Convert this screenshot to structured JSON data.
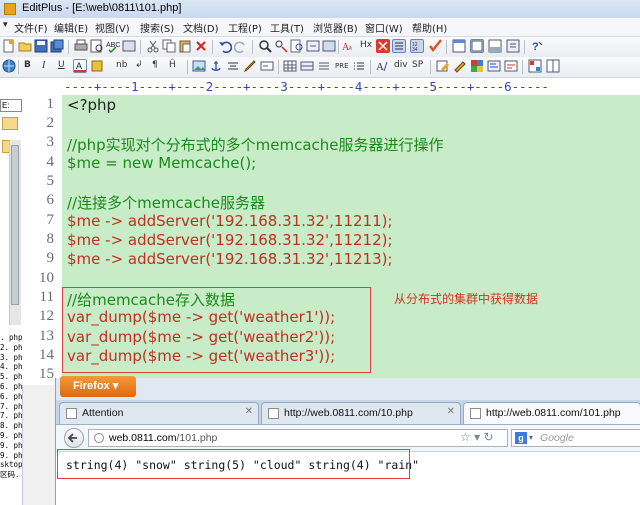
{
  "window": {
    "title": "EditPlus - [E:\\web\\0811\\101.php]"
  },
  "menu": [
    "文件(F)",
    "编辑(E)",
    "视图(V)",
    "搜索(S)",
    "文档(D)",
    "工程(P)",
    "工具(T)",
    "浏览器(B)",
    "窗口(W)",
    "帮助(H)"
  ],
  "toolbar2_text": {
    "nb": "nb",
    "tt": "tt",
    "div": "div",
    "sp": "SP",
    "hx": "Hx"
  },
  "sidebar": {
    "drive": "E:",
    "files": [
      ". php",
      "2. php",
      "3. php",
      "4. php",
      "5. php",
      "6. ph",
      "6. ph",
      "7. ph",
      "7. ph",
      "8. ph",
      "9. ph",
      "9. ph",
      "9. ph",
      "sktop",
      "区码. z"
    ]
  },
  "ruler": "----+----1----+----2----+----3----+----4----+----5----+----6-----",
  "editor": {
    "lines": [
      {
        "n": "1",
        "text": "<?php"
      },
      {
        "n": "2",
        "text": ""
      },
      {
        "n": "3",
        "text": "//php实现对个分布式的多个memcache服务器进行操作"
      },
      {
        "n": "4",
        "text": "$me = new Memcache();"
      },
      {
        "n": "5",
        "text": ""
      },
      {
        "n": "6",
        "text": "//连接多个memcache服务器"
      },
      {
        "n": "7",
        "text": "$me -> addServer('192.168.31.32',11211);"
      },
      {
        "n": "8",
        "text": "$me -> addServer('192.168.31.32',11212);"
      },
      {
        "n": "9",
        "text": "$me -> addServer('192.168.31.32',11213);"
      },
      {
        "n": "10",
        "text": ""
      },
      {
        "n": "11",
        "text": "//给memcache存入数据"
      },
      {
        "n": "12",
        "text": "var_dump($me -> get('weather1'));"
      },
      {
        "n": "13",
        "text": "var_dump($me -> get('weather2'));"
      },
      {
        "n": "14",
        "text": "var_dump($me -> get('weather3'));"
      },
      {
        "n": "15",
        "text": ""
      }
    ]
  },
  "annotation": "从分布式的集群中获得数据",
  "browser": {
    "firefox_button": "Firefox",
    "tabs": [
      {
        "label": "Attention"
      },
      {
        "label": "http://web.0811.com/10.php"
      },
      {
        "label": "http://web.0811.com/101.php"
      }
    ],
    "url_host": "web.0811.com",
    "url_path": "/101.php",
    "search_placeholder": "Google",
    "output": "string(4) \"snow\" string(5) \"cloud\" string(4) \"rain\""
  },
  "colors": {
    "editor_bg": "#c8ecc8",
    "comment": "#1a8a1a",
    "keyword": "#c03020",
    "highlight_box": "#e04040",
    "firefox_orange": "#e0680e"
  }
}
